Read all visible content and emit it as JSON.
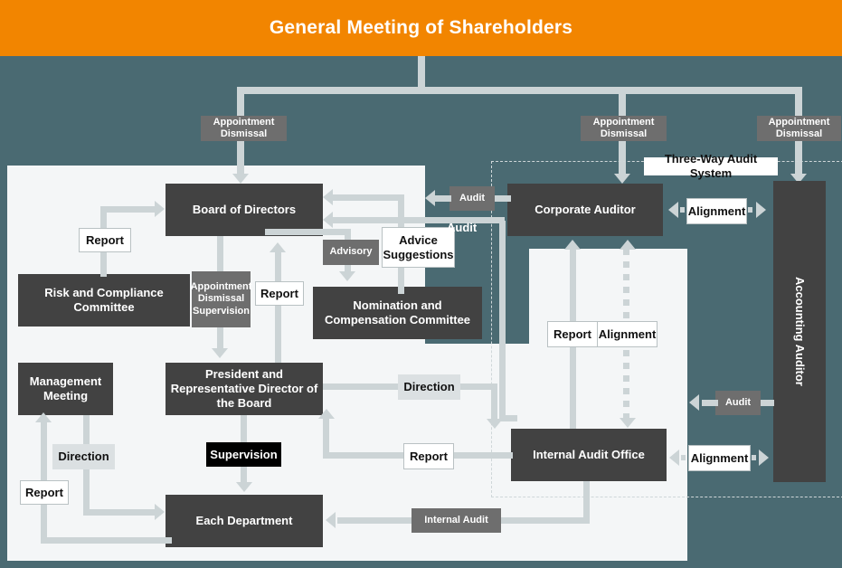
{
  "header": {
    "title": "General Meeting of Shareholders"
  },
  "nodes": {
    "board": "Board of Directors",
    "risk_committee": "Risk and Compliance Committee",
    "nomination_committee": "Nomination and Compensation Committee",
    "management_meeting": "Management Meeting",
    "president": "President and Representative Director of the Board",
    "each_department": "Each Department",
    "corporate_auditor": "Corporate Auditor",
    "internal_audit_office": "Internal Audit Office",
    "accounting_auditor": "Accounting Auditor"
  },
  "labels": {
    "appointment_dismissal_1": "Appointment Dismissal",
    "appointment_dismissal_2": "Appointment Dismissal",
    "appointment_dismissal_3": "Appointment Dismissal",
    "appointment_dismissal_supervision": "Appointment Dismissal Supervision",
    "report_risk": "Report",
    "report_nomination": "Report",
    "advisory": "Advisory",
    "advice_suggestions": "Advice Suggestions",
    "audit_board": "Audit",
    "audit_internal": "Audit",
    "alignment_top": "Alignment",
    "alignment_mid": "Alignment",
    "alignment_bottom": "Alignment",
    "report_corporate_auditor": "Report",
    "direction_management": "Direction",
    "report_management": "Report",
    "supervision": "Supervision",
    "direction_audit": "Direction",
    "report_audit": "Report",
    "internal_audit": "Internal Audit",
    "audit_accounting": "Audit",
    "three_way": "Three-Way Audit System"
  },
  "colors": {
    "header_orange": "#f28500",
    "background_teal": "#4a6a72",
    "panel_white": "#f4f6f7",
    "node_dark": "#424242",
    "connector_gray": "#ccd4d6",
    "label_gray": "#6e6e6e"
  }
}
